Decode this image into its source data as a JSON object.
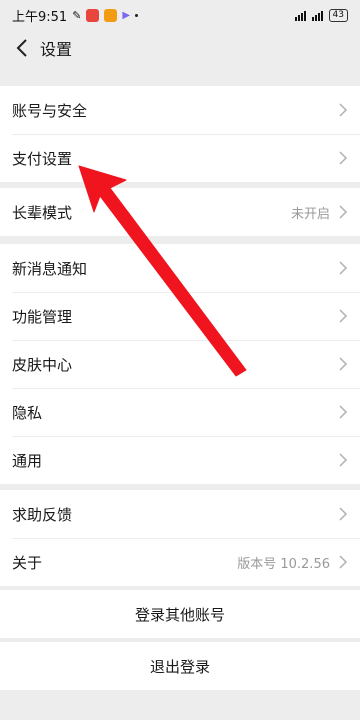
{
  "status_bar": {
    "time": "上午9:51",
    "battery": "43"
  },
  "header": {
    "title": "设置"
  },
  "groups": [
    {
      "items": [
        {
          "label": "账号与安全"
        },
        {
          "label": "支付设置"
        }
      ]
    },
    {
      "items": [
        {
          "label": "长辈模式",
          "value": "未开启"
        }
      ]
    },
    {
      "items": [
        {
          "label": "新消息通知"
        },
        {
          "label": "功能管理"
        },
        {
          "label": "皮肤中心"
        },
        {
          "label": "隐私"
        },
        {
          "label": "通用"
        }
      ]
    },
    {
      "items": [
        {
          "label": "求助反馈"
        },
        {
          "label": "关于",
          "value": "版本号 10.2.56"
        }
      ]
    }
  ],
  "actions": {
    "switch_account": "登录其他账号",
    "logout": "退出登录"
  },
  "colors": {
    "annotation_arrow": "#f0141e",
    "background": "#ededed"
  }
}
